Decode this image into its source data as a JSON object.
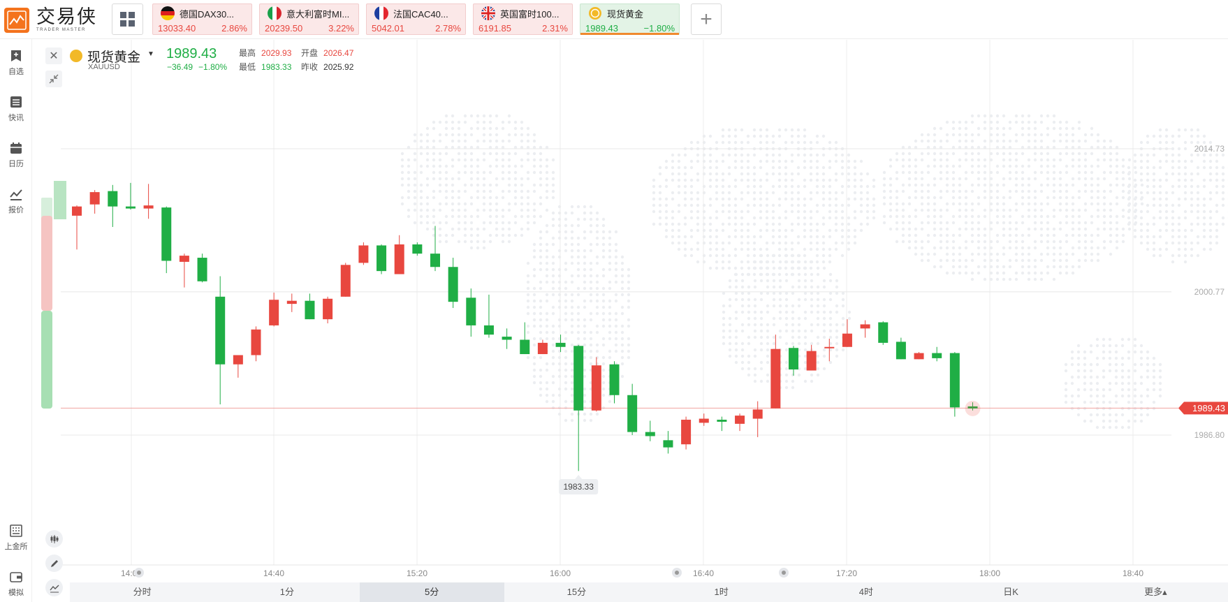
{
  "app": {
    "logo_name": "交易侠",
    "logo_sub": "TRADER MASTER"
  },
  "colors": {
    "up": "#e8473f",
    "down": "#1fae45",
    "accent": "#f4731d"
  },
  "tabs": [
    {
      "name": "德国DAX30...",
      "price": "13033.40",
      "change": "2.86%",
      "dir": "up",
      "flag": "de"
    },
    {
      "name": "意大利富时MI...",
      "price": "20239.50",
      "change": "3.22%",
      "dir": "up",
      "flag": "it"
    },
    {
      "name": "法国CAC40...",
      "price": "5042.01",
      "change": "2.78%",
      "dir": "up",
      "flag": "fr"
    },
    {
      "name": "英国富时100...",
      "price": "6191.85",
      "change": "2.31%",
      "dir": "up",
      "flag": "gb"
    },
    {
      "name": "现货黄金",
      "price": "1989.43",
      "change": "−1.80%",
      "dir": "down",
      "flag": "gold",
      "active": true
    }
  ],
  "sidebar": {
    "items": [
      {
        "label": "自选",
        "icon": "bookmark-icon"
      },
      {
        "label": "快讯",
        "icon": "news-icon"
      },
      {
        "label": "日历",
        "icon": "calendar-icon"
      },
      {
        "label": "报价",
        "icon": "chart-line-icon"
      },
      {
        "label": "上金所",
        "icon": "exchange-icon"
      },
      {
        "label": "模拟",
        "icon": "wallet-icon"
      }
    ]
  },
  "symbol": {
    "name": "现货黄金",
    "code": "XAUUSD",
    "price": "1989.43",
    "change": "−36.49",
    "change_pct": "−1.80%",
    "high_label": "最高",
    "high": "2029.93",
    "low_label": "最低",
    "low": "1983.33",
    "open_label": "开盘",
    "open": "2026.47",
    "prev_label": "昨收",
    "prev": "2025.92"
  },
  "chart_data": {
    "type": "candlestick",
    "y_ticks": [
      2014.73,
      2000.77,
      1986.8
    ],
    "y_tick_labels": [
      "2014.73",
      "2000.77",
      "1986.80"
    ],
    "x_tick_labels": [
      "14:00",
      "14:40",
      "15:20",
      "16:00",
      "16:40",
      "17:20",
      "18:00",
      "18:40"
    ],
    "last_price": 1989.43,
    "last_price_label": "1989.43",
    "low_marker_label": "1983.33",
    "candles": [
      {
        "o": 2008.2,
        "c": 2009.1,
        "h": 2009.2,
        "l": 2004.9
      },
      {
        "o": 2009.3,
        "c": 2010.5,
        "h": 2010.7,
        "l": 2008.4
      },
      {
        "o": 2010.6,
        "c": 2009.1,
        "h": 2011.2,
        "l": 2007.1
      },
      {
        "o": 2009.1,
        "c": 2008.9,
        "h": 2011.4,
        "l": 2008.8
      },
      {
        "o": 2008.9,
        "c": 2009.2,
        "h": 2011.3,
        "l": 2007.9
      },
      {
        "o": 2009.0,
        "c": 2003.8,
        "h": 2009.1,
        "l": 2002.6
      },
      {
        "o": 2003.7,
        "c": 2004.3,
        "h": 2004.5,
        "l": 2001.2
      },
      {
        "o": 2004.1,
        "c": 2001.8,
        "h": 2004.5,
        "l": 2001.7
      },
      {
        "o": 2000.3,
        "c": 1993.7,
        "h": 2002.3,
        "l": 1989.8
      },
      {
        "o": 1993.7,
        "c": 1994.6,
        "h": 1994.6,
        "l": 1992.4
      },
      {
        "o": 1994.6,
        "c": 1997.1,
        "h": 1997.4,
        "l": 1994.0
      },
      {
        "o": 1997.5,
        "c": 2000.0,
        "h": 2000.7,
        "l": 1997.4
      },
      {
        "o": 1999.6,
        "c": 1999.9,
        "h": 2000.6,
        "l": 1998.8
      },
      {
        "o": 1999.9,
        "c": 1998.1,
        "h": 2000.6,
        "l": 1998.1
      },
      {
        "o": 1998.1,
        "c": 2000.1,
        "h": 2000.3,
        "l": 1997.7
      },
      {
        "o": 2000.3,
        "c": 2003.4,
        "h": 2003.6,
        "l": 2000.3
      },
      {
        "o": 2003.6,
        "c": 2005.3,
        "h": 2005.6,
        "l": 2003.4
      },
      {
        "o": 2005.3,
        "c": 2002.8,
        "h": 2005.4,
        "l": 2002.5
      },
      {
        "o": 2002.5,
        "c": 2005.4,
        "h": 2006.3,
        "l": 2002.5
      },
      {
        "o": 2005.4,
        "c": 2004.5,
        "h": 2005.6,
        "l": 2004.3
      },
      {
        "o": 2004.5,
        "c": 2003.2,
        "h": 2007.2,
        "l": 2002.8
      },
      {
        "o": 2003.2,
        "c": 1999.8,
        "h": 2004.1,
        "l": 1999.2
      },
      {
        "o": 2000.2,
        "c": 1997.5,
        "h": 2001.1,
        "l": 1996.4
      },
      {
        "o": 1997.5,
        "c": 1996.6,
        "h": 2000.5,
        "l": 1996.3
      },
      {
        "o": 1996.4,
        "c": 1996.1,
        "h": 1997.2,
        "l": 1995.2
      },
      {
        "o": 1996.1,
        "c": 1994.7,
        "h": 1997.8,
        "l": 1994.7
      },
      {
        "o": 1994.7,
        "c": 1995.8,
        "h": 1996.1,
        "l": 1994.7
      },
      {
        "o": 1995.8,
        "c": 1995.4,
        "h": 1996.6,
        "l": 1994.9
      },
      {
        "o": 1995.5,
        "c": 1989.2,
        "h": 1995.6,
        "l": 1983.3
      },
      {
        "o": 1989.2,
        "c": 1993.6,
        "h": 1994.4,
        "l": 1989.1
      },
      {
        "o": 1993.7,
        "c": 1990.7,
        "h": 1994.0,
        "l": 1989.9
      },
      {
        "o": 1990.7,
        "c": 1987.1,
        "h": 1991.8,
        "l": 1986.8
      },
      {
        "o": 1987.1,
        "c": 1986.7,
        "h": 1988.2,
        "l": 1986.2
      },
      {
        "o": 1986.3,
        "c": 1985.6,
        "h": 1987.2,
        "l": 1985.0
      },
      {
        "o": 1985.9,
        "c": 1988.3,
        "h": 1988.6,
        "l": 1985.4
      },
      {
        "o": 1988.0,
        "c": 1988.4,
        "h": 1988.9,
        "l": 1987.7
      },
      {
        "o": 1988.3,
        "c": 1988.1,
        "h": 1988.6,
        "l": 1987.2
      },
      {
        "o": 1987.9,
        "c": 1988.7,
        "h": 1988.9,
        "l": 1987.2
      },
      {
        "o": 1988.4,
        "c": 1989.3,
        "h": 1990.1,
        "l": 1986.6
      },
      {
        "o": 1989.4,
        "c": 1995.2,
        "h": 1996.6,
        "l": 1989.4
      },
      {
        "o": 1995.3,
        "c": 1993.2,
        "h": 1995.5,
        "l": 1992.6
      },
      {
        "o": 1993.1,
        "c": 1995.0,
        "h": 1995.6,
        "l": 1993.1
      },
      {
        "o": 1995.3,
        "c": 1995.4,
        "h": 1996.2,
        "l": 1994.0
      },
      {
        "o": 1995.4,
        "c": 1996.7,
        "h": 1998.1,
        "l": 1995.4
      },
      {
        "o": 1997.2,
        "c": 1997.6,
        "h": 1998.0,
        "l": 1996.3
      },
      {
        "o": 1997.8,
        "c": 1995.8,
        "h": 1997.9,
        "l": 1995.6
      },
      {
        "o": 1995.9,
        "c": 1994.2,
        "h": 1996.3,
        "l": 1994.2
      },
      {
        "o": 1994.2,
        "c": 1994.8,
        "h": 1994.9,
        "l": 1994.2
      },
      {
        "o": 1994.8,
        "c": 1994.3,
        "h": 1995.4,
        "l": 1994.0
      },
      {
        "o": 1994.8,
        "c": 1989.5,
        "h": 1994.9,
        "l": 1988.6
      },
      {
        "o": 1989.6,
        "c": 1989.4,
        "h": 1990.0,
        "l": 1989.2
      }
    ]
  },
  "timeframes": [
    {
      "label": "分时",
      "selected": false
    },
    {
      "label": "1分",
      "selected": false
    },
    {
      "label": "5分",
      "selected": true
    },
    {
      "label": "15分",
      "selected": false
    },
    {
      "label": "1时",
      "selected": false
    },
    {
      "label": "4时",
      "selected": false
    },
    {
      "label": "日K",
      "selected": false
    },
    {
      "label": "更多▴",
      "selected": false
    }
  ]
}
